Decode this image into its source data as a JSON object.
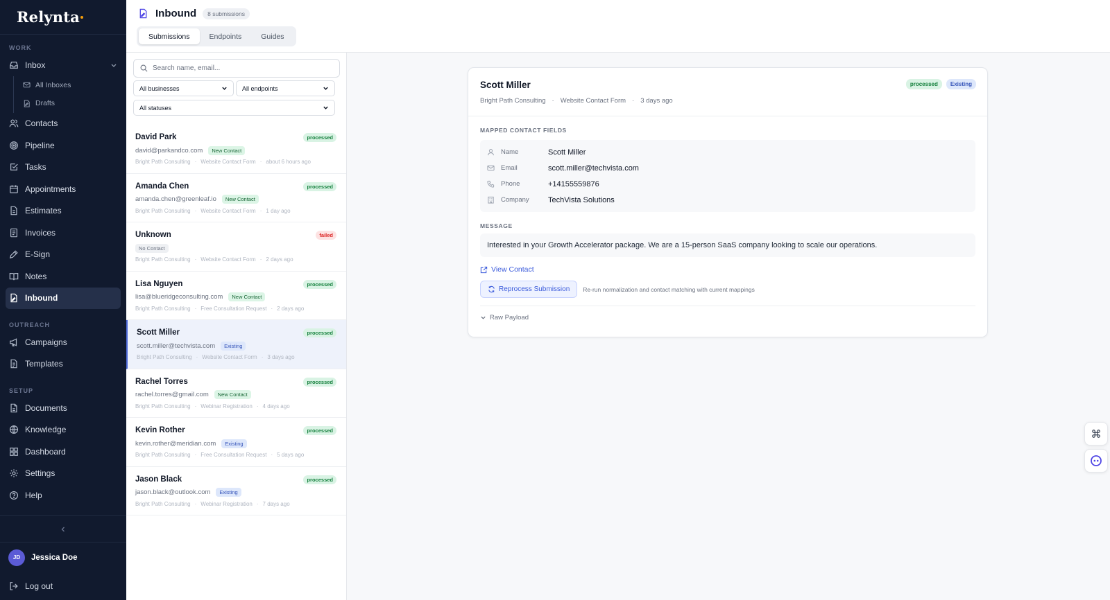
{
  "app": {
    "brand": "Relynta"
  },
  "sidebar": {
    "sections": {
      "work": "WORK",
      "outreach": "OUTREACH",
      "setup": "SETUP"
    },
    "inbox": {
      "label": "Inbox",
      "subs": [
        "All Inboxes",
        "Drafts"
      ]
    },
    "work_items": [
      "Contacts",
      "Pipeline",
      "Tasks",
      "Appointments",
      "Estimates",
      "Invoices",
      "E-Sign",
      "Notes",
      "Inbound"
    ],
    "outreach_items": [
      "Campaigns",
      "Templates"
    ],
    "setup_items": [
      "Documents",
      "Knowledge",
      "Dashboard",
      "Settings",
      "Help"
    ],
    "user": {
      "initials": "JD",
      "name": "Jessica Doe"
    },
    "logout": "Log out"
  },
  "header": {
    "title": "Inbound",
    "count": "8 submissions",
    "tabs": [
      "Submissions",
      "Endpoints",
      "Guides"
    ]
  },
  "list": {
    "search_placeholder": "Search name, email...",
    "filters": {
      "business": "All businesses",
      "endpoint": "All endpoints",
      "status": "All statuses"
    },
    "rows": [
      {
        "name": "David Park",
        "status": "processed",
        "email": "david@parkandco.com",
        "badge": "New Contact",
        "business": "Bright Path Consulting",
        "form": "Website Contact Form",
        "time": "about 6 hours ago"
      },
      {
        "name": "Amanda Chen",
        "status": "processed",
        "email": "amanda.chen@greenleaf.io",
        "badge": "New Contact",
        "business": "Bright Path Consulting",
        "form": "Website Contact Form",
        "time": "1 day ago"
      },
      {
        "name": "Unknown",
        "status": "failed",
        "email": "",
        "badge": "No Contact",
        "business": "Bright Path Consulting",
        "form": "Website Contact Form",
        "time": "2 days ago"
      },
      {
        "name": "Lisa Nguyen",
        "status": "processed",
        "email": "lisa@blueridgeconsulting.com",
        "badge": "New Contact",
        "business": "Bright Path Consulting",
        "form": "Free Consultation Request",
        "time": "2 days ago"
      },
      {
        "name": "Scott Miller",
        "status": "processed",
        "email": "scott.miller@techvista.com",
        "badge": "Existing",
        "business": "Bright Path Consulting",
        "form": "Website Contact Form",
        "time": "3 days ago"
      },
      {
        "name": "Rachel Torres",
        "status": "processed",
        "email": "rachel.torres@gmail.com",
        "badge": "New Contact",
        "business": "Bright Path Consulting",
        "form": "Webinar Registration",
        "time": "4 days ago"
      },
      {
        "name": "Kevin Rother",
        "status": "processed",
        "email": "kevin.rother@meridian.com",
        "badge": "Existing",
        "business": "Bright Path Consulting",
        "form": "Free Consultation Request",
        "time": "5 days ago"
      },
      {
        "name": "Jason Black",
        "status": "processed",
        "email": "jason.black@outlook.com",
        "badge": "Existing",
        "business": "Bright Path Consulting",
        "form": "Webinar Registration",
        "time": "7 days ago"
      }
    ]
  },
  "detail": {
    "name": "Scott Miller",
    "status": "processed",
    "match": "Existing",
    "business": "Bright Path Consulting",
    "form": "Website Contact Form",
    "time": "3 days ago",
    "mapped_title": "MAPPED CONTACT FIELDS",
    "fields": {
      "name": {
        "label": "Name",
        "value": "Scott Miller"
      },
      "email": {
        "label": "Email",
        "value": "scott.miller@techvista.com"
      },
      "phone": {
        "label": "Phone",
        "value": "+14155559876"
      },
      "company": {
        "label": "Company",
        "value": "TechVista Solutions"
      }
    },
    "message_title": "MESSAGE",
    "message": "Interested in your Growth Accelerator package. We are a 15-person SaaS company looking to scale our operations.",
    "view_contact": "View Contact",
    "reprocess": "Reprocess Submission",
    "reprocess_help": "Re-run normalization and contact matching with current mappings",
    "raw_payload": "Raw Payload"
  },
  "colors": {
    "sidebar_bg": "#111a2e",
    "accent": "#4f46e5",
    "processed": "#15803d",
    "failed": "#dc2626"
  }
}
